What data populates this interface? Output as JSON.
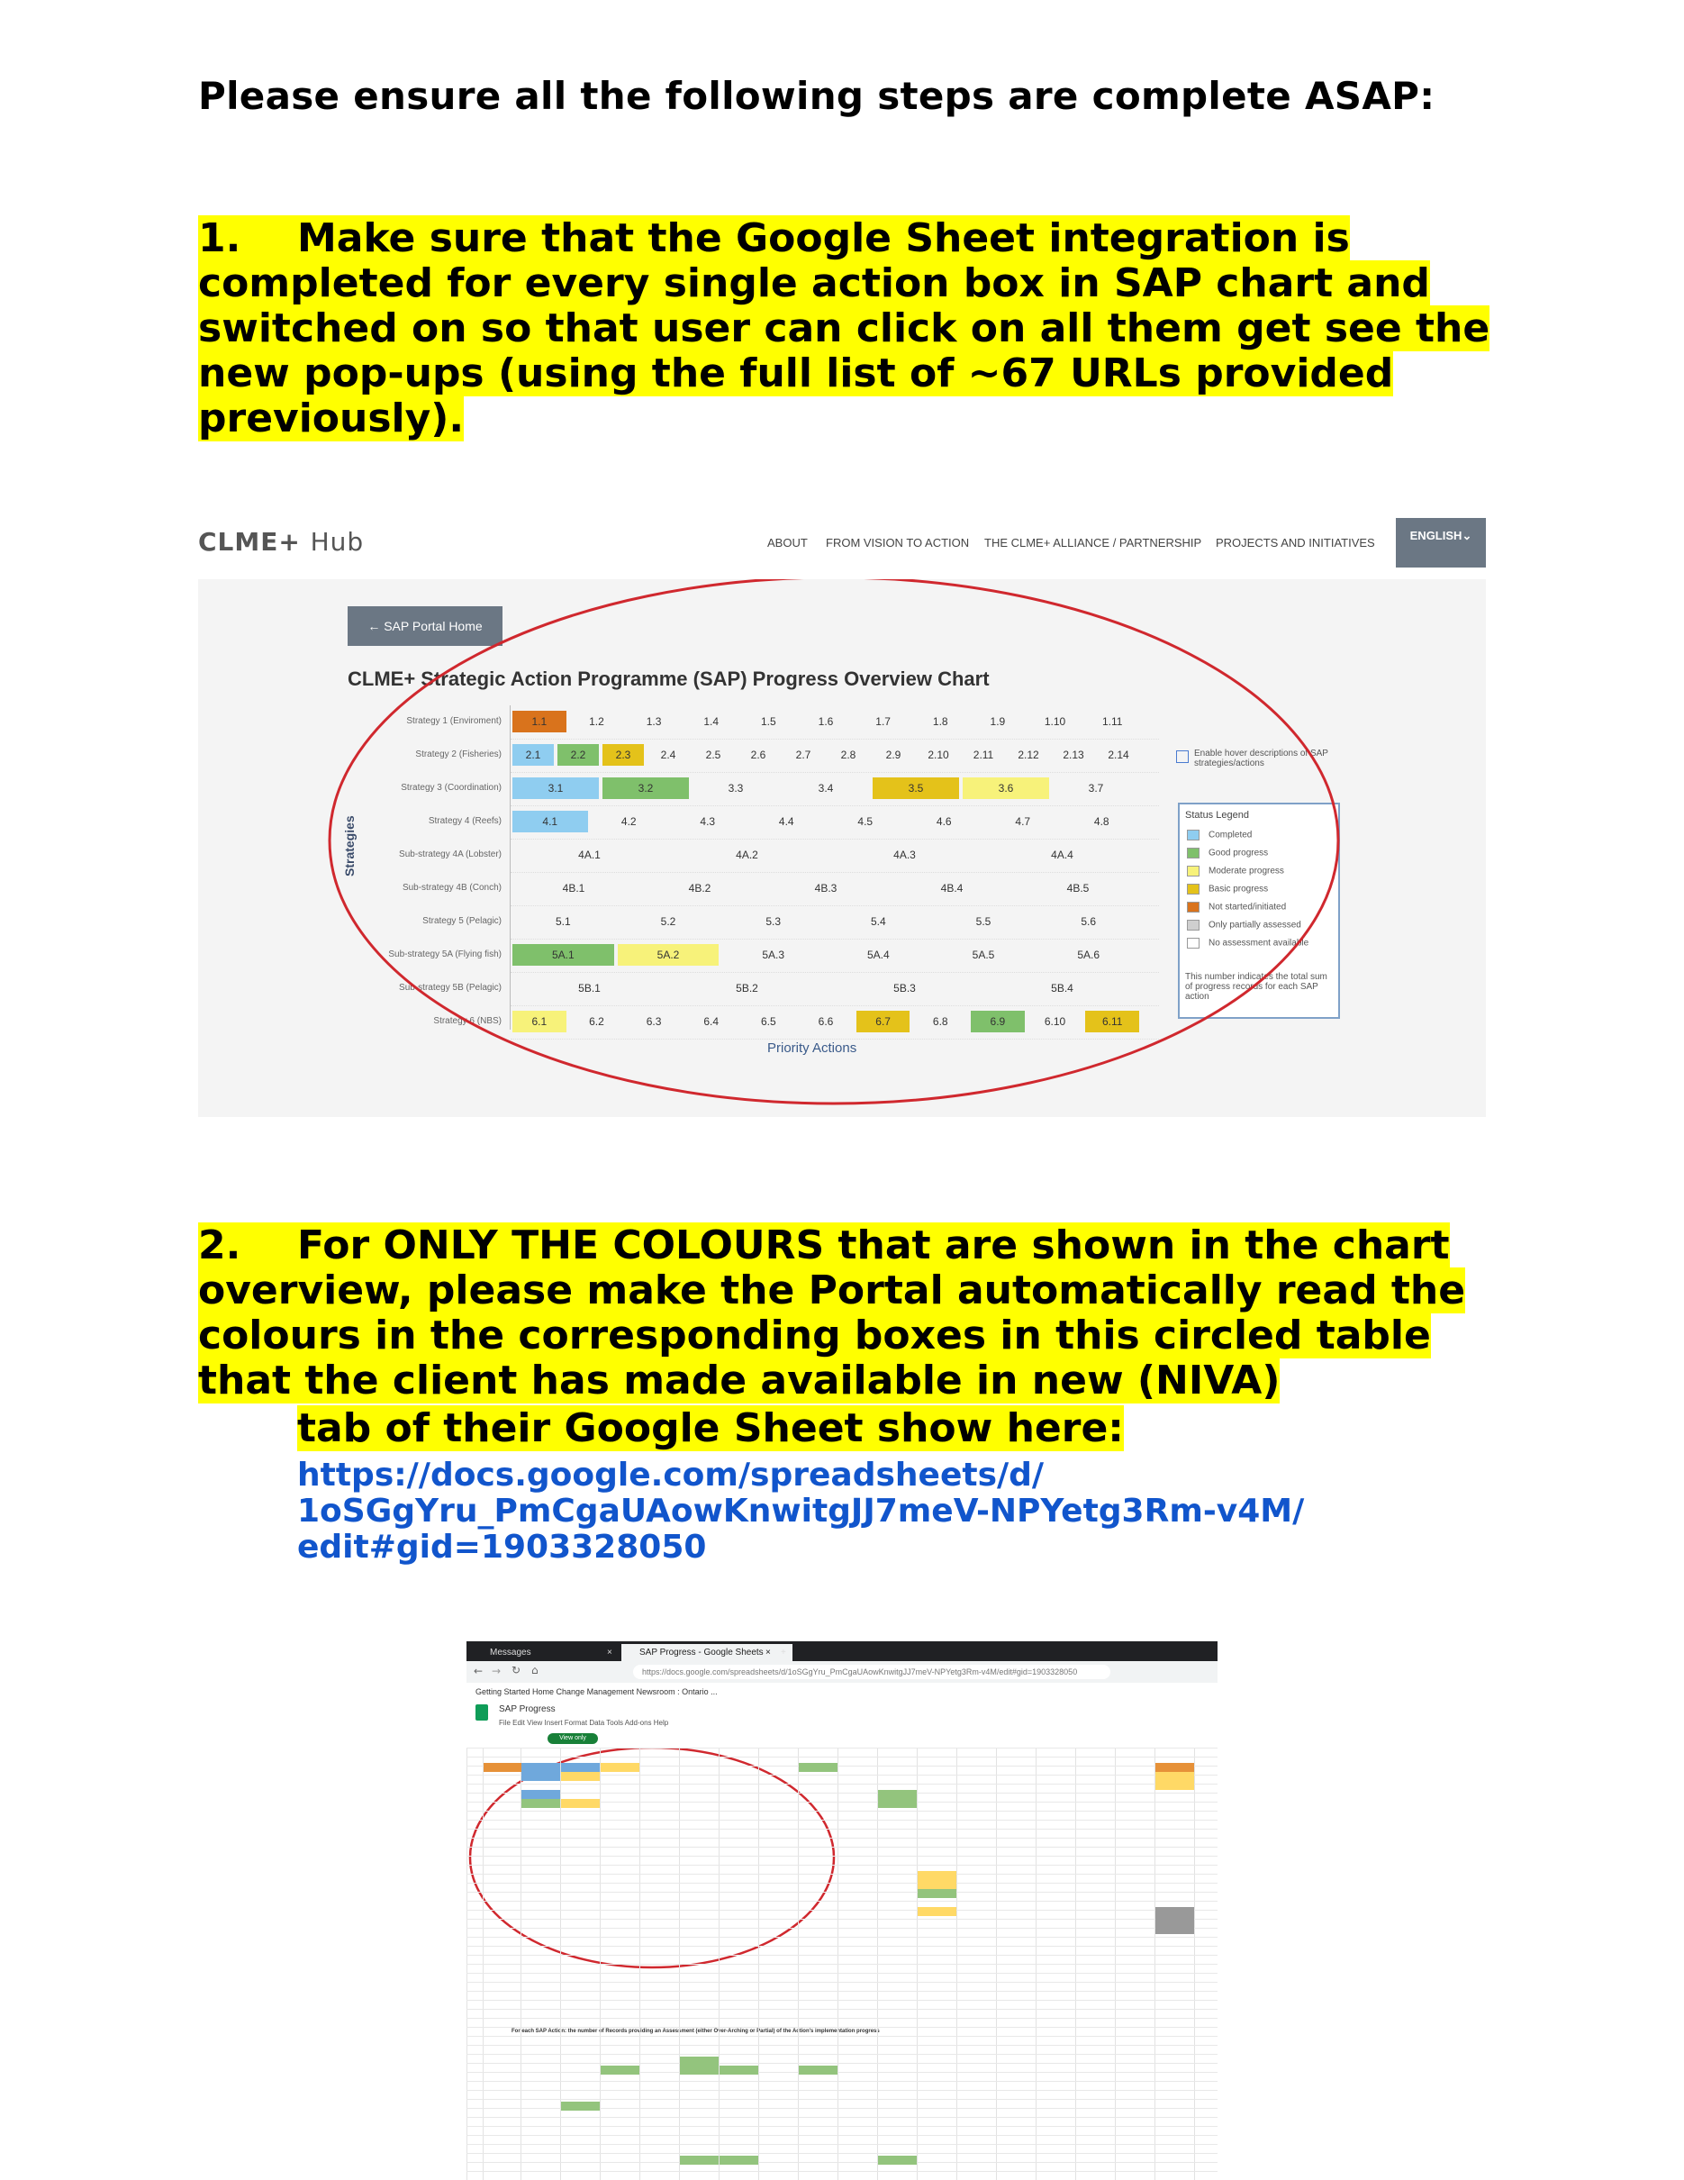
{
  "heading": "Please ensure all the following steps are complete ASAP:",
  "step1": {
    "number": "1.",
    "text": "Make sure that the Google Sheet integration is completed for every single action box in SAP chart and switched on so that user can click on all them get see the new pop-ups (using the full list of ~67 URLs provided previously)."
  },
  "step2": {
    "number": "2.",
    "text": "For ONLY THE COLOURS that are shown in the chart overview, please make the Portal automatically read the colours in the corresponding boxes in this circled table that the client has made available in new (NIVA)",
    "text_cont": "tab of their Google Sheet show here:",
    "link_l1": "https://docs.google.com/spreadsheets/d/",
    "link_l2": "1oSGgYru_PmCgaUAowKnwitgJJ7meV-NPYetg3Rm-v4M/",
    "link_l3": "edit#gid=1903328050"
  },
  "screenshot1": {
    "logo_main": "CLME+",
    "logo_sub": "Hub",
    "nav": [
      "ABOUT",
      "FROM VISION TO ACTION",
      "THE CLME+ ALLIANCE / PARTNERSHIP",
      "PROJECTS AND INITIATIVES"
    ],
    "language": "ENGLISH",
    "back_button": "← SAP Portal Home",
    "chart_title": "CLME+ Strategic Action Programme (SAP) Progress Overview Chart",
    "y_axis_label": "Strategies",
    "x_axis_label": "Priority Actions",
    "hover_label": "Enable hover descriptions of SAP strategies/actions",
    "legend_title": "Status Legend",
    "legend": [
      {
        "label": "Completed",
        "color": "#8fcdf0"
      },
      {
        "label": "Good progress",
        "color": "#7fc06b"
      },
      {
        "label": "Moderate progress",
        "color": "#f7f27a"
      },
      {
        "label": "Basic progress",
        "color": "#e4c21a"
      },
      {
        "label": "Not started/initiated",
        "color": "#d9731c"
      },
      {
        "label": "Only partially assessed",
        "color": "#cfcfcf"
      },
      {
        "label": "No assessment available",
        "color": "#ffffff"
      }
    ],
    "legend_note": "This number indicates the total sum of progress records for each SAP action",
    "rows": [
      {
        "label": "Strategy 1 (Enviroment)",
        "cells": [
          {
            "t": "1.1",
            "c": "#d9731c"
          },
          {
            "t": "1.2"
          },
          {
            "t": "1.3"
          },
          {
            "t": "1.4"
          },
          {
            "t": "1.5"
          },
          {
            "t": "1.6"
          },
          {
            "t": "1.7"
          },
          {
            "t": "1.8"
          },
          {
            "t": "1.9"
          },
          {
            "t": "1.10"
          },
          {
            "t": "1.11"
          }
        ]
      },
      {
        "label": "Strategy 2 (Fisheries)",
        "cells": [
          {
            "t": "2.1",
            "c": "#8fcdf0"
          },
          {
            "t": "2.2",
            "c": "#7fc06b"
          },
          {
            "t": "2.3",
            "c": "#e4c21a"
          },
          {
            "t": "2.4"
          },
          {
            "t": "2.5"
          },
          {
            "t": "2.6"
          },
          {
            "t": "2.7"
          },
          {
            "t": "2.8"
          },
          {
            "t": "2.9"
          },
          {
            "t": "2.10"
          },
          {
            "t": "2.11"
          },
          {
            "t": "2.12"
          },
          {
            "t": "2.13"
          },
          {
            "t": "2.14"
          }
        ]
      },
      {
        "label": "Strategy 3 (Coordination)",
        "cells": [
          {
            "t": "3.1",
            "c": "#8fcdf0"
          },
          {
            "t": "3.2",
            "c": "#7fc06b"
          },
          {
            "t": "3.3"
          },
          {
            "t": "3.4"
          },
          {
            "t": "3.5",
            "c": "#e4c21a"
          },
          {
            "t": "3.6",
            "c": "#f7f27a"
          },
          {
            "t": "3.7"
          }
        ]
      },
      {
        "label": "Strategy 4 (Reefs)",
        "cells": [
          {
            "t": "4.1",
            "c": "#8fcdf0"
          },
          {
            "t": "4.2"
          },
          {
            "t": "4.3"
          },
          {
            "t": "4.4"
          },
          {
            "t": "4.5"
          },
          {
            "t": "4.6"
          },
          {
            "t": "4.7"
          },
          {
            "t": "4.8"
          }
        ]
      },
      {
        "label": "Sub-strategy 4A (Lobster)",
        "cells": [
          {
            "t": "4A.1"
          },
          {
            "t": "4A.2"
          },
          {
            "t": "4A.3"
          },
          {
            "t": "4A.4"
          }
        ]
      },
      {
        "label": "Sub-strategy 4B (Conch)",
        "cells": [
          {
            "t": "4B.1"
          },
          {
            "t": "4B.2"
          },
          {
            "t": "4B.3"
          },
          {
            "t": "4B.4"
          },
          {
            "t": "4B.5"
          }
        ]
      },
      {
        "label": "Strategy 5 (Pelagic)",
        "cells": [
          {
            "t": "5.1"
          },
          {
            "t": "5.2"
          },
          {
            "t": "5.3"
          },
          {
            "t": "5.4"
          },
          {
            "t": "5.5"
          },
          {
            "t": "5.6"
          }
        ]
      },
      {
        "label": "Sub-strategy 5A (Flying fish)",
        "cells": [
          {
            "t": "5A.1",
            "c": "#7fc06b"
          },
          {
            "t": "5A.2",
            "c": "#f7f27a"
          },
          {
            "t": "5A.3"
          },
          {
            "t": "5A.4"
          },
          {
            "t": "5A.5"
          },
          {
            "t": "5A.6"
          }
        ]
      },
      {
        "label": "Sub-strategy 5B (Pelagic)",
        "cells": [
          {
            "t": "5B.1"
          },
          {
            "t": "5B.2"
          },
          {
            "t": "5B.3"
          },
          {
            "t": "5B.4"
          }
        ]
      },
      {
        "label": "Strategy 6 (NBS)",
        "cells": [
          {
            "t": "6.1",
            "c": "#f7f27a"
          },
          {
            "t": "6.2"
          },
          {
            "t": "6.3"
          },
          {
            "t": "6.4"
          },
          {
            "t": "6.5"
          },
          {
            "t": "6.6"
          },
          {
            "t": "6.7",
            "c": "#e4c21a"
          },
          {
            "t": "6.8"
          },
          {
            "t": "6.9",
            "c": "#7fc06b"
          },
          {
            "t": "6.10"
          },
          {
            "t": "6.11",
            "c": "#e4c21a"
          }
        ]
      }
    ]
  },
  "screenshot2": {
    "tab1": "Messages",
    "tab2": "SAP Progress - Google Sheets",
    "url": "https://docs.google.com/spreadsheets/d/1oSGgYru_PmCgaUAowKnwitgJJ7meV-NPYetg3Rm-v4M/edit#gid=1903328050",
    "bookmarks": "Getting Started   Home   Change Management   Newsroom : Ontario ...",
    "doc_title": "SAP Progress",
    "menu": "File   Edit   View   Insert   Format   Data   Tools   Add-ons   Help",
    "view_only": "View only",
    "lower_title": "For each SAP Action: the number of Records providing an Assessment (either Over-Arching or Partial) of the Action's implementation progress"
  },
  "colors": {
    "highlight": "#ffff00",
    "link": "#1155cc",
    "circle": "#d0282e"
  }
}
